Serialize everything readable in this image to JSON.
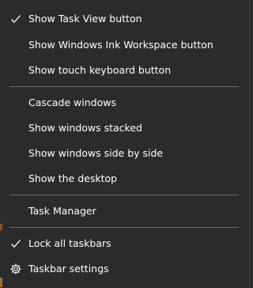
{
  "menu": {
    "items": [
      {
        "label": "Show Task View button",
        "checked": true,
        "icon": "checkmark-icon"
      },
      {
        "label": "Show Windows Ink Workspace button",
        "checked": false
      },
      {
        "label": "Show touch keyboard button",
        "checked": false
      },
      {
        "label": "Cascade windows",
        "checked": false
      },
      {
        "label": "Show windows stacked",
        "checked": false
      },
      {
        "label": "Show windows side by side",
        "checked": false
      },
      {
        "label": "Show the desktop",
        "checked": false
      },
      {
        "label": "Task Manager",
        "checked": false
      },
      {
        "label": "Lock all taskbars",
        "checked": true,
        "icon": "checkmark-icon"
      },
      {
        "label": "Taskbar settings",
        "checked": false,
        "icon": "gear-icon"
      }
    ]
  },
  "colors": {
    "background": "#2b2b2b",
    "text": "#ffffff",
    "separator": "#6b6b6b"
  }
}
